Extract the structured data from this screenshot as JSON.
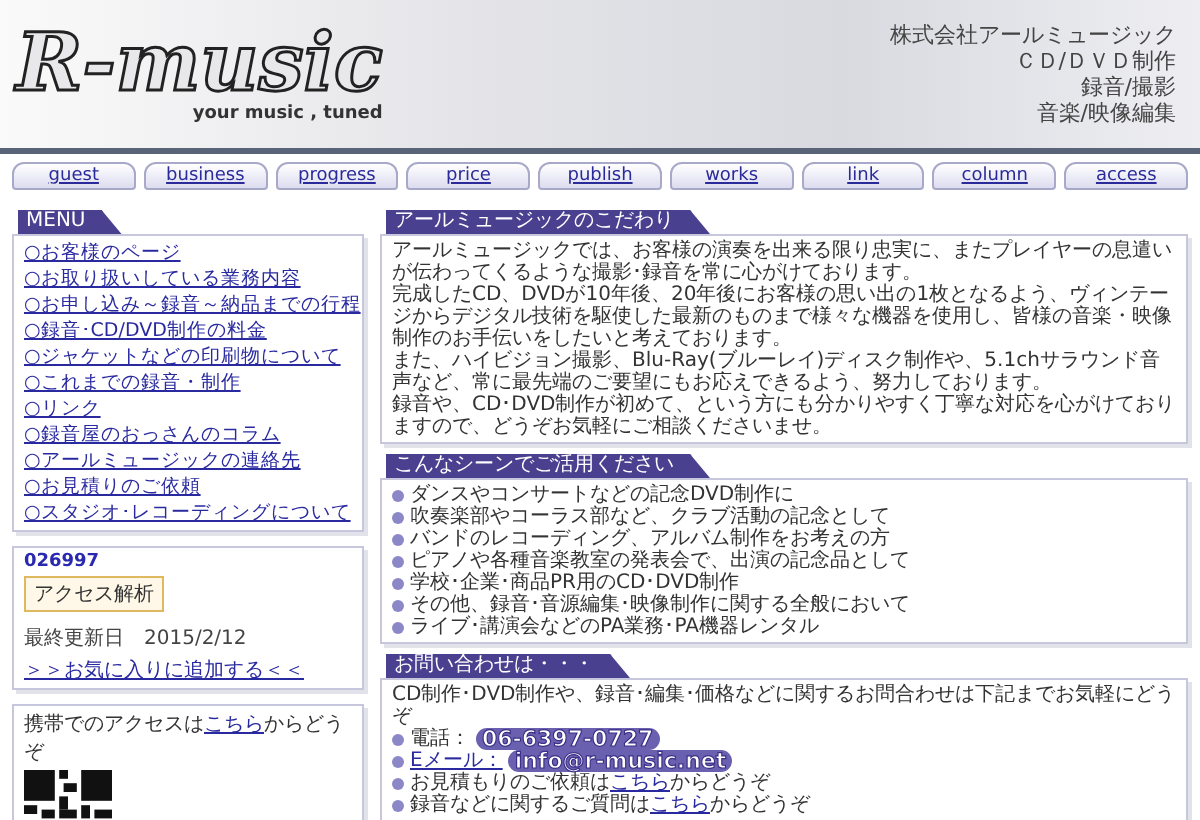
{
  "header": {
    "logo": "R-music",
    "tagline": "your music , tuned",
    "company_lines": [
      "株式会社アールミュージック",
      "ＣＤ/ＤＶＤ制作",
      "録音/撮影",
      "音楽/映像編集"
    ]
  },
  "nav": [
    {
      "label": "guest"
    },
    {
      "label": "business"
    },
    {
      "label": "progress"
    },
    {
      "label": "price"
    },
    {
      "label": "publish"
    },
    {
      "label": "works"
    },
    {
      "label": "link"
    },
    {
      "label": "column"
    },
    {
      "label": "access"
    }
  ],
  "menu": {
    "title": "MENU",
    "items": [
      "○お客様のページ",
      "○お取り扱いしている業務内容",
      "○お申し込み～録音～納品までの行程",
      "○録音･CD/DVD制作の料金",
      "○ジャケットなどの印刷物について",
      "○これまでの録音・制作",
      "○リンク",
      "○録音屋のおっさんのコラム",
      "○アールミュージックの連絡先",
      "○お見積りのご依頼",
      "○スタジオ･レコーディングについて"
    ]
  },
  "counter": {
    "count": "026997",
    "badge": "アクセス解析",
    "updated": "最終更新日　2015/2/12",
    "favorite_link": "＞＞お気に入りに追加する＜＜"
  },
  "mobile": {
    "before": "携帯でのアクセスは",
    "link": "こちら",
    "after": "からどうぞ"
  },
  "sections": [
    {
      "kind": "paragraph",
      "title": "アールミュージックのこだわり",
      "lines": [
        "アールミュージックでは、お客様の演奏を出来る限り忠実に、またプレイヤーの息遣いが伝わってくるような撮影･録音を常に心がけております。",
        "完成したCD、DVDが10年後、20年後にお客様の思い出の1枚となるよう、ヴィンテージからデジタル技術を駆使した最新のものまで様々な機器を使用し、皆様の音楽・映像制作のお手伝いをしたいと考えております。",
        "また、ハイビジョン撮影、Blu-Ray(ブルーレイ)ディスク制作や、5.1chサラウンド音声など、常に最先端のご要望にもお応えできるよう、努力しております。",
        "録音や、CD･DVD制作が初めて、という方にも分かりやすく丁寧な対応を心がけておりますので、どうぞお気軽にご相談くださいませ。"
      ]
    },
    {
      "kind": "list",
      "title": "こんなシーンでご活用ください",
      "items": [
        "ダンスやコンサートなどの記念DVD制作に",
        "吹奏楽部やコーラス部など、クラブ活動の記念として",
        "バンドのレコーディング、アルバム制作をお考えの方",
        "ピアノや各種音楽教室の発表会で、出演の記念品として",
        "学校･企業･商品PR用のCD･DVD制作",
        "その他、録音･音源編集･映像制作に関する全般において",
        "ライブ･講演会などのPA業務･PA機器レンタル"
      ]
    },
    {
      "kind": "contact",
      "title": "お問い合わせは・・・",
      "intro": "CD制作･DVD制作や、録音･編集･価格などに関するお問合わせは下記までお気軽にどうぞ",
      "items": [
        {
          "kind": "phone",
          "label": "電話：",
          "value": "06-6397-0727"
        },
        {
          "kind": "email",
          "label": "Eメール：",
          "value": "info@r-music.net"
        },
        {
          "kind": "text",
          "before": "お見積もりのご依頼は",
          "link": "こちら",
          "after": "からどうぞ"
        },
        {
          "kind": "text",
          "before": "録音などに関するご質問は",
          "link": "こちら",
          "after": "からどうぞ"
        }
      ]
    }
  ]
}
